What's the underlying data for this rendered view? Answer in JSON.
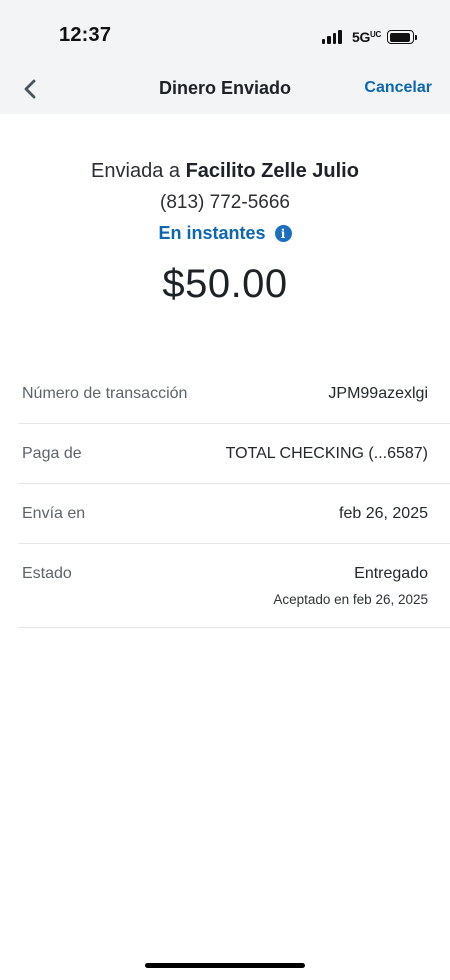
{
  "status_bar": {
    "time": "12:37",
    "network": "5G",
    "network_suffix": "UC"
  },
  "nav": {
    "back_icon": "chevron-left-icon",
    "title": "Dinero Enviado",
    "cancel_label": "Cancelar"
  },
  "summary": {
    "sent_prefix": "Enviada a",
    "recipient_name": "Facilito Zelle Julio",
    "recipient_phone": "(813) 772-5666",
    "speed_label": "En instantes",
    "info_icon": "info-icon",
    "amount": "$50.00"
  },
  "details": {
    "rows": [
      {
        "label": "Número de transacción",
        "value": "JPM99azexlgi"
      },
      {
        "label": "Paga de",
        "value": "TOTAL CHECKING (...6587)"
      },
      {
        "label": "Envía en",
        "value": "feb 26, 2025"
      },
      {
        "label": "Estado",
        "value": "Entregado",
        "subvalue": "Aceptado en feb 26, 2025"
      }
    ]
  },
  "colors": {
    "accent": "#0e66b3",
    "header_background": "#f3f4f6",
    "divider": "#e4e6e8"
  }
}
